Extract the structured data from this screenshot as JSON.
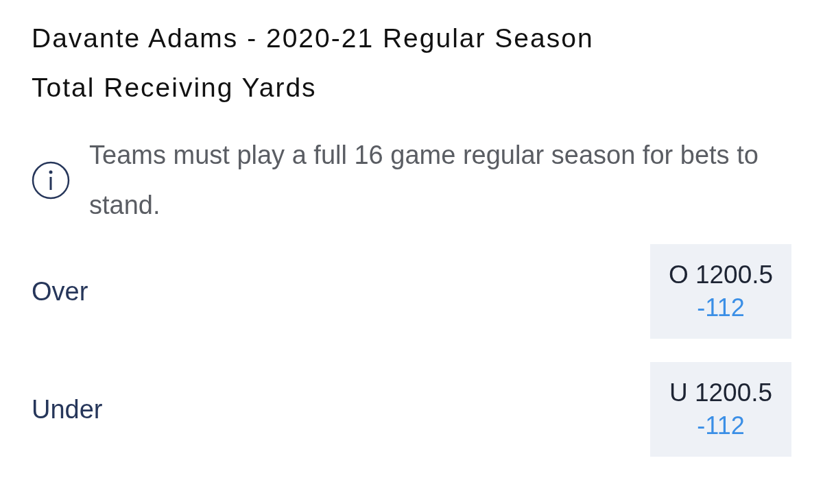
{
  "title_lines": [
    "Davante Adams - 2020-21 Regular Season",
    "Total Receiving Yards"
  ],
  "notice": {
    "text": "Teams must play a full 16 game regular season for bets to stand."
  },
  "outcomes": [
    {
      "label": "Over",
      "line": "O 1200.5",
      "odds": "-112"
    },
    {
      "label": "Under",
      "line": "U 1200.5",
      "odds": "-112"
    }
  ]
}
